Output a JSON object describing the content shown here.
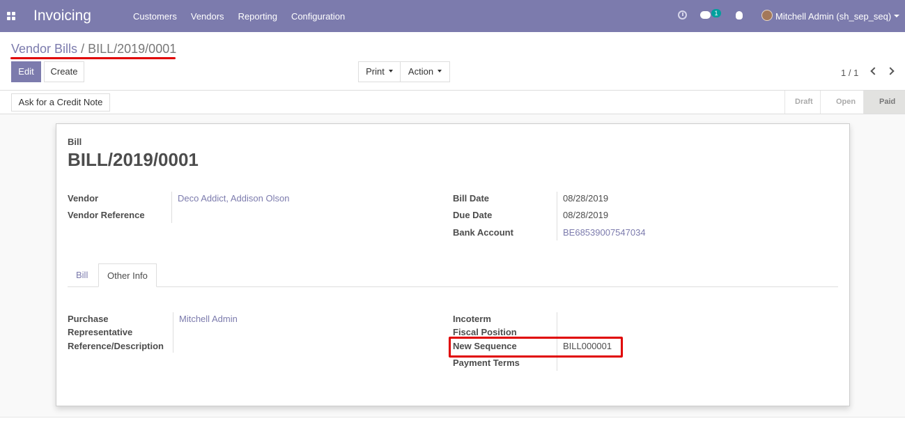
{
  "navbar": {
    "app_name": "Invoicing",
    "menu": [
      "Customers",
      "Vendors",
      "Reporting",
      "Configuration"
    ],
    "chat_badge": "1",
    "user": "Mitchell Admin (sh_sep_seq)"
  },
  "breadcrumb": {
    "parent": "Vendor Bills",
    "separator": "/",
    "current": "BILL/2019/0001"
  },
  "buttons": {
    "edit": "Edit",
    "create": "Create",
    "print": "Print",
    "action": "Action",
    "credit_note": "Ask for a Credit Note"
  },
  "pager": "1 / 1",
  "stages": [
    "Draft",
    "Open",
    "Paid"
  ],
  "active_stage": "Paid",
  "form": {
    "doc_type": "Bill",
    "title": "BILL/2019/0001",
    "vendor_label": "Vendor",
    "vendor_value": "Deco Addict, Addison Olson",
    "vendor_ref_label": "Vendor Reference",
    "bill_date_label": "Bill Date",
    "bill_date_value": "08/28/2019",
    "due_date_label": "Due Date",
    "due_date_value": "08/28/2019",
    "bank_label": "Bank Account",
    "bank_value": "BE68539007547034"
  },
  "tabs": [
    "Bill",
    "Other Info"
  ],
  "other_info": {
    "purchase_rep_label_1": "Purchase",
    "purchase_rep_label_2": "Representative",
    "purchase_rep_value": "Mitchell Admin",
    "ref_desc_label": "Reference/Description",
    "incoterm_label": "Incoterm",
    "fiscal_label": "Fiscal Position",
    "new_seq_label": "New Sequence",
    "new_seq_value": "BILL000001",
    "payment_terms_label": "Payment Terms"
  },
  "colors": {
    "brand": "#7c7bad",
    "highlight": "#e00000"
  }
}
